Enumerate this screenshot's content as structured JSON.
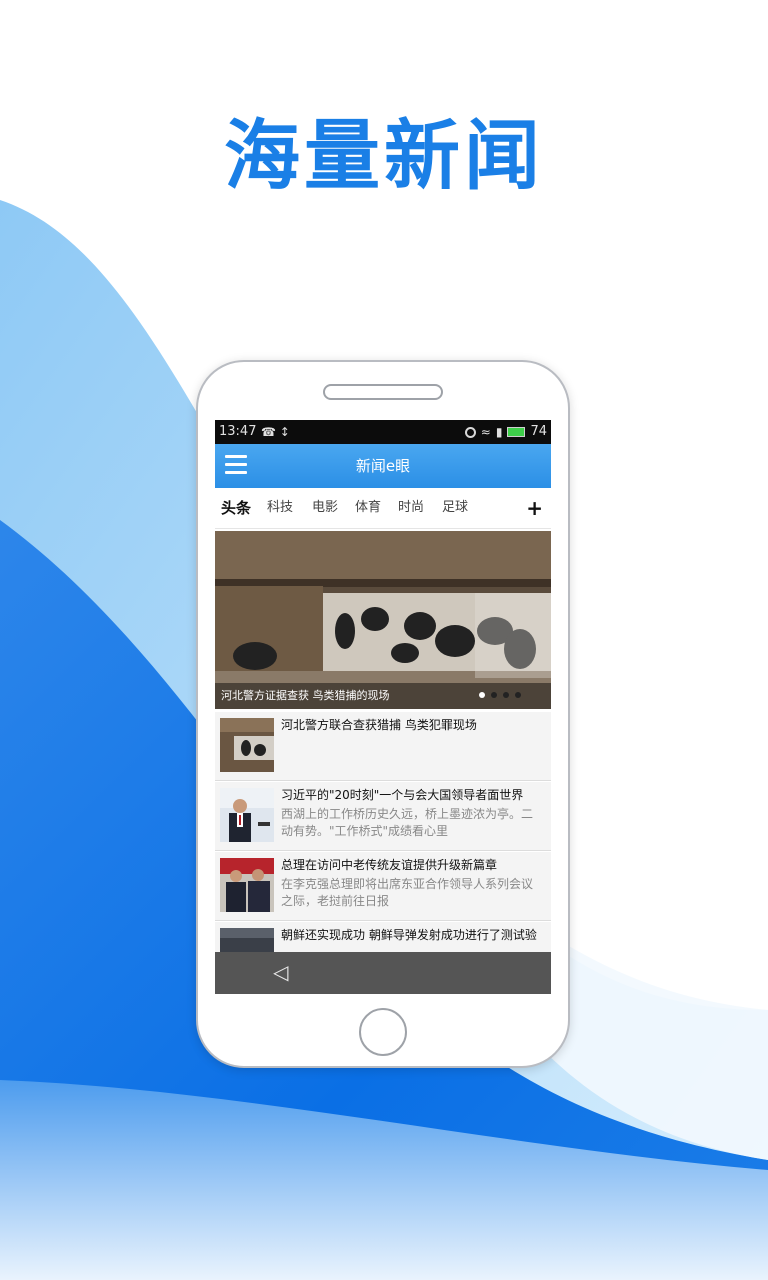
{
  "headline": "海量新闻",
  "colors": {
    "headline_blue": "#1a7fe6",
    "wave_deep": "#0a6fe5",
    "wave_light": "#bfe3fb",
    "appbar_blue": "#2b8fe6"
  },
  "status_bar": {
    "time": "13:47",
    "left_icons": "☎ ↕",
    "battery_level": "74"
  },
  "app_bar": {
    "menu_icon": "hamburger-menu-icon",
    "title": "新闻e眼"
  },
  "tabs": [
    {
      "label": "头条",
      "active": true
    },
    {
      "label": "科技",
      "active": false
    },
    {
      "label": "电影",
      "active": false
    },
    {
      "label": "体育",
      "active": false
    },
    {
      "label": "时尚",
      "active": false
    },
    {
      "label": "足球",
      "active": false
    }
  ],
  "tab_add": "+",
  "hero": {
    "caption": "河北警方证据查获 鸟类猎捕的现场"
  },
  "news": [
    {
      "title": "河北警方联合查获猎捕 鸟类犯罪现场",
      "summary": ""
    },
    {
      "title": "习近平的\"20时刻\"一个与会大国领导者面世界",
      "summary": "西湖上的工作桥历史久远，桥上墨迹浓为亭。二动有势。\"工作桥式\"成绩看心里"
    },
    {
      "title": "总理在访问中老传统友谊提供升级新篇章",
      "summary": "在李克强总理即将出席东亚合作领导人系列会议之际，老挝前往日报"
    },
    {
      "title": "朝鲜还实现成功 朝鲜导弹发射成功进行了测试验",
      "summary": ""
    }
  ],
  "nav_bar": {
    "back_icon": "◁"
  }
}
